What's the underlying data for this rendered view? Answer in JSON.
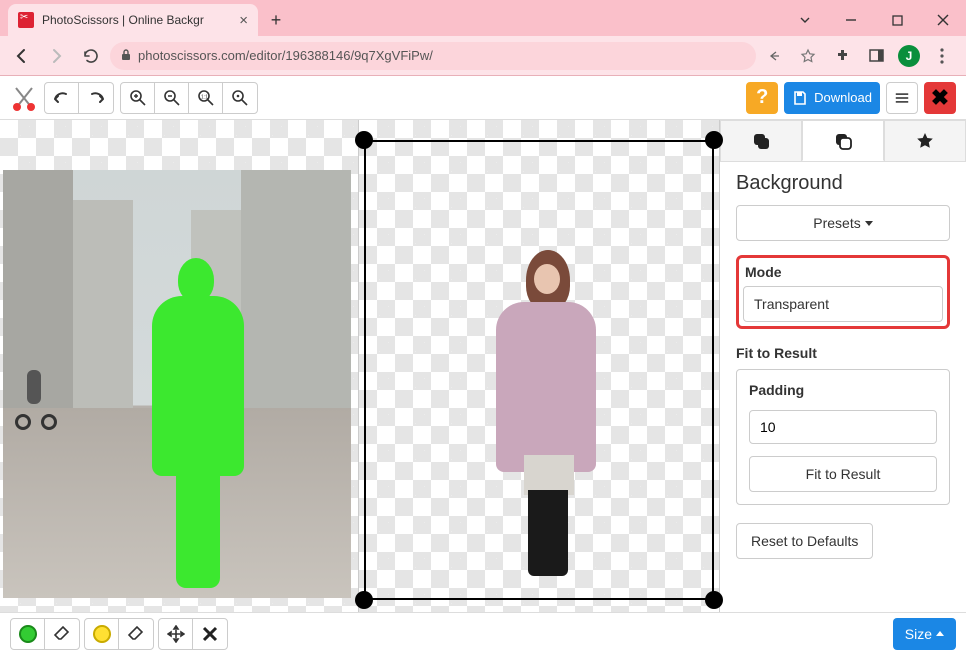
{
  "browser": {
    "tab_title": "PhotoScissors | Online Backgr",
    "url_display": "photoscissors.com/editor/196388146/9q7XgVFiPw/",
    "avatar_initial": "J"
  },
  "toolbar": {
    "download_label": "Download"
  },
  "side": {
    "background_title": "Background",
    "presets_label": "Presets",
    "mode_label": "Mode",
    "mode_value": "Transparent",
    "fit_title": "Fit to Result",
    "padding_label": "Padding",
    "padding_value": "10",
    "fit_button": "Fit to Result",
    "reset_button": "Reset to Defaults"
  },
  "bottom": {
    "size_label": "Size"
  }
}
